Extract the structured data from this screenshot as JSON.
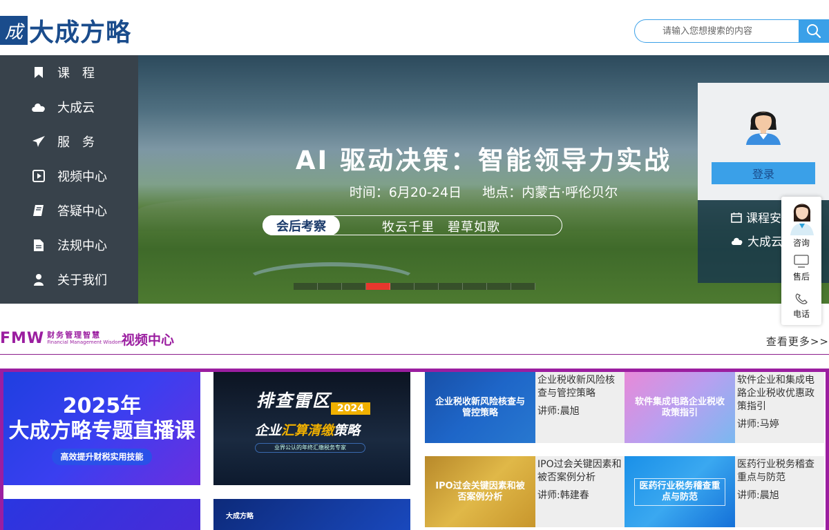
{
  "header": {
    "logo_text": "大成方略",
    "logo_mark": "成",
    "search_placeholder": "请输入您想搜索的内容"
  },
  "sidenav": {
    "items": [
      {
        "label": "课　程",
        "icon": "bookmark-icon"
      },
      {
        "label": "大成云",
        "icon": "cloud-icon"
      },
      {
        "label": "服　务",
        "icon": "paper-plane-icon"
      },
      {
        "label": "视频中心",
        "icon": "play-square-icon"
      },
      {
        "label": "答疑中心",
        "icon": "book-icon"
      },
      {
        "label": "法规中心",
        "icon": "file-icon"
      },
      {
        "label": "关于我们",
        "icon": "user-icon"
      }
    ]
  },
  "banner": {
    "title": "AI 驱动决策：智能领导力实战",
    "time": "时间：6月20-24日",
    "place": "地点：内蒙古·呼伦贝尔",
    "tag": "会后考察",
    "slogan": "牧云千里　碧草如歌",
    "slides_count": 10,
    "active_slide": 3
  },
  "login": {
    "button": "登录",
    "links": [
      {
        "label": "课程安排",
        "icon": "calendar-icon"
      },
      {
        "label": "大成云",
        "icon": "cloud-icon"
      }
    ]
  },
  "float_widget": {
    "consult": "咨询",
    "after_sales": "售后",
    "phone": "电话"
  },
  "video_center": {
    "brand_letters": "FMW",
    "brand_cn": "财务管理智慧",
    "brand_en": "Financial Management Wisdom",
    "title": "视频中心",
    "more": "查看更多>>"
  },
  "featured": {
    "t1_title_line1": "2025年",
    "t1_title_line2": "大成方略专题直播课",
    "t1_pill": "高效提升财税实用技能",
    "t2_title": "排查雷区",
    "t2_year": "2024",
    "t2_sub_pre": "企业",
    "t2_sub_hl": "汇算清缴",
    "t2_sub_post": "策略",
    "t2_foot": "业界公认的年终汇缴税务专家",
    "t4_logo": "大成方略"
  },
  "courses": [
    {
      "thumb": "企业税收新风险核查与管控策略",
      "title": "企业税收新风险核查与管控策略",
      "lecturer": "讲师:晨旭"
    },
    {
      "thumb": "软件集成电路企业税收政策指引",
      "title": "软件企业和集成电路企业税收优惠政策指引",
      "lecturer": "讲师:马婷"
    },
    {
      "thumb": "IPO过会关键因素和被否案例分析",
      "title": "IPO过会关键因素和被否案例分析",
      "lecturer": "讲师:韩建春"
    },
    {
      "thumb": "医药行业税务稽查重点与防范",
      "title": "医药行业税务稽查重点与防范",
      "lecturer": "讲师:晨旭"
    }
  ]
}
